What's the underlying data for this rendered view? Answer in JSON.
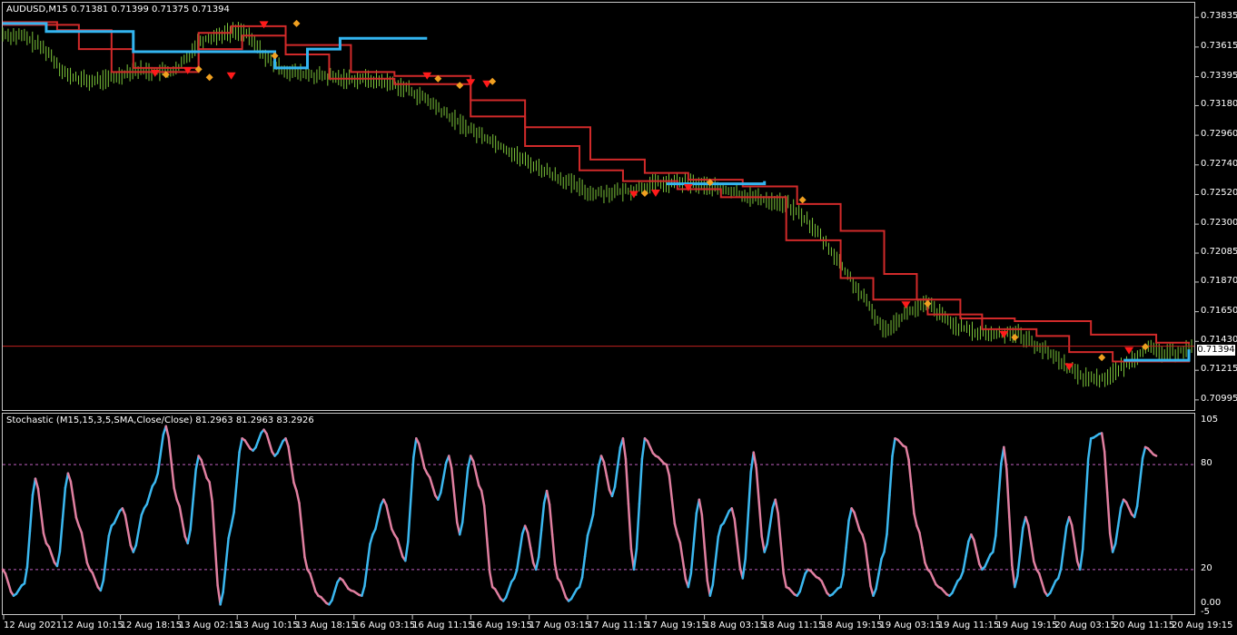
{
  "main_title": "AUDUSD,M15  0.71381 0.71399 0.71375 0.71394",
  "stoch_title": "Stochastic (M15,15,3,5,SMA,Close/Close) 81.2963 81.2963 83.2926",
  "current_price": "0.71394",
  "colors": {
    "background": "#000000",
    "frame": "#c8c8c8",
    "bars": "#7cc53a",
    "resistance_line": "#d12a2a",
    "support_line": "#33b5f0",
    "bid_line": "#c0201f",
    "sell_marker": "#ff1a1a",
    "signal_marker": "#f0a020",
    "stoch_up": "#3bb8f0",
    "stoch_down": "#e07fa0",
    "level_line": "#c060c0"
  },
  "chart_data": [
    {
      "type": "line",
      "subtype": "price-bars-with-trailing-stops",
      "symbol": "AUDUSD",
      "timeframe": "M15",
      "y_ticks": [
        "0.73835",
        "0.73615",
        "0.73395",
        "0.73180",
        "0.72960",
        "0.72740",
        "0.72520",
        "0.72300",
        "0.72085",
        "0.71870",
        "0.71650",
        "0.71430",
        "0.71215",
        "0.70995"
      ],
      "ylim": [
        0.7092,
        0.7387
      ],
      "bid": 0.71394,
      "x_labels": [
        "12 Aug 2021",
        "12 Aug 10:15",
        "12 Aug 18:15",
        "13 Aug 02:15",
        "13 Aug 10:15",
        "13 Aug 18:15",
        "16 Aug 03:15",
        "16 Aug 11:15",
        "16 Aug 19:15",
        "17 Aug 03:15",
        "17 Aug 11:15",
        "17 Aug 19:15",
        "18 Aug 03:15",
        "18 Aug 11:15",
        "18 Aug 19:15",
        "19 Aug 03:15",
        "19 Aug 11:15",
        "19 Aug 19:15",
        "20 Aug 03:15",
        "20 Aug 11:15",
        "20 Aug 19:15"
      ],
      "price_path": [
        [
          0,
          0.7371
        ],
        [
          4,
          0.7369
        ],
        [
          8,
          0.7359
        ],
        [
          12,
          0.734
        ],
        [
          16,
          0.7336
        ],
        [
          20,
          0.7338
        ],
        [
          24,
          0.7345
        ],
        [
          28,
          0.7343
        ],
        [
          32,
          0.7344
        ],
        [
          36,
          0.7366
        ],
        [
          40,
          0.7371
        ],
        [
          44,
          0.7374
        ],
        [
          46,
          0.7365
        ],
        [
          50,
          0.7347
        ],
        [
          54,
          0.7342
        ],
        [
          58,
          0.734
        ],
        [
          62,
          0.7338
        ],
        [
          66,
          0.7338
        ],
        [
          70,
          0.7336
        ],
        [
          74,
          0.7331
        ],
        [
          78,
          0.7322
        ],
        [
          82,
          0.731
        ],
        [
          86,
          0.73
        ],
        [
          90,
          0.7292
        ],
        [
          96,
          0.7277
        ],
        [
          102,
          0.7265
        ],
        [
          108,
          0.7253
        ],
        [
          114,
          0.7254
        ],
        [
          120,
          0.726
        ],
        [
          126,
          0.7261
        ],
        [
          132,
          0.7256
        ],
        [
          138,
          0.725
        ],
        [
          144,
          0.7245
        ],
        [
          148,
          0.7232
        ],
        [
          152,
          0.7212
        ],
        [
          156,
          0.7188
        ],
        [
          160,
          0.7164
        ],
        [
          162,
          0.7151
        ],
        [
          166,
          0.7164
        ],
        [
          170,
          0.7171
        ],
        [
          174,
          0.7157
        ],
        [
          178,
          0.715
        ],
        [
          182,
          0.7148
        ],
        [
          186,
          0.715
        ],
        [
          190,
          0.714
        ],
        [
          194,
          0.713
        ],
        [
          198,
          0.7117
        ],
        [
          202,
          0.7115
        ],
        [
          206,
          0.7124
        ],
        [
          210,
          0.7138
        ],
        [
          214,
          0.7133
        ],
        [
          218,
          0.7138
        ]
      ],
      "series": [
        {
          "name": "",
          "role": "resistance-stop",
          "points": [
            [
              0,
              0.738
            ],
            [
              10,
              0.7378
            ],
            [
              14,
              0.736
            ],
            [
              24,
              0.7346
            ],
            [
              36,
              0.7372
            ],
            [
              42,
              0.7377
            ],
            [
              52,
              0.7363
            ],
            [
              64,
              0.7343
            ],
            [
              72,
              0.734
            ],
            [
              86,
              0.7322
            ],
            [
              96,
              0.7302
            ],
            [
              108,
              0.7278
            ],
            [
              118,
              0.7268
            ],
            [
              126,
              0.7263
            ],
            [
              136,
              0.7258
            ],
            [
              146,
              0.7245
            ],
            [
              154,
              0.7225
            ],
            [
              162,
              0.7193
            ],
            [
              168,
              0.7174
            ],
            [
              176,
              0.716
            ],
            [
              186,
              0.7158
            ],
            [
              200,
              0.7148
            ],
            [
              212,
              0.7142
            ],
            [
              218,
              0.7141
            ]
          ]
        },
        {
          "name": "",
          "role": "resistance-stop-2",
          "points": [
            [
              0,
              0.7378
            ],
            [
              10,
              0.7374
            ],
            [
              20,
              0.7343
            ],
            [
              36,
              0.736
            ],
            [
              44,
              0.737
            ],
            [
              52,
              0.7356
            ],
            [
              60,
              0.7338
            ],
            [
              72,
              0.7334
            ],
            [
              86,
              0.731
            ],
            [
              96,
              0.7288
            ],
            [
              106,
              0.727
            ],
            [
              114,
              0.7262
            ],
            [
              124,
              0.7256
            ],
            [
              132,
              0.725
            ],
            [
              144,
              0.7218
            ],
            [
              154,
              0.719
            ],
            [
              160,
              0.7174
            ],
            [
              170,
              0.7163
            ],
            [
              180,
              0.7152
            ],
            [
              190,
              0.7147
            ],
            [
              196,
              0.7135
            ],
            [
              204,
              0.7128
            ],
            [
              218,
              0.7136
            ]
          ]
        },
        {
          "name": "",
          "role": "support-stop",
          "points": [
            [
              0,
              0.7379
            ],
            [
              8,
              0.7373
            ],
            [
              22,
              0.7373
            ],
            [
              24,
              0.7358
            ],
            [
              50,
              0.7346
            ],
            [
              56,
              0.736
            ],
            [
              62,
              0.7368
            ],
            [
              78,
              0.7368
            ]
          ]
        },
        {
          "name": "",
          "role": "support-stop",
          "points": [
            [
              122,
              0.726
            ],
            [
              140,
              0.7262
            ]
          ]
        },
        {
          "name": "",
          "role": "support-stop",
          "points": [
            [
              206,
              0.7129
            ],
            [
              218,
              0.7137
            ]
          ]
        }
      ],
      "sell_markers": [
        [
          28,
          0.7342
        ],
        [
          34,
          0.7344
        ],
        [
          42,
          0.734
        ],
        [
          48,
          0.7378
        ],
        [
          78,
          0.734
        ],
        [
          86,
          0.7335
        ],
        [
          89,
          0.7334
        ],
        [
          116,
          0.7252
        ],
        [
          120,
          0.7253
        ],
        [
          126,
          0.7257
        ],
        [
          166,
          0.717
        ],
        [
          184,
          0.7148
        ],
        [
          196,
          0.7124
        ],
        [
          207,
          0.7136
        ]
      ],
      "signal_markers": [
        [
          30,
          0.7341
        ],
        [
          36,
          0.7345
        ],
        [
          38,
          0.7339
        ],
        [
          50,
          0.7355
        ],
        [
          54,
          0.7379
        ],
        [
          80,
          0.7338
        ],
        [
          84,
          0.7333
        ],
        [
          90,
          0.7336
        ],
        [
          118,
          0.7253
        ],
        [
          130,
          0.7261
        ],
        [
          147,
          0.7248
        ],
        [
          170,
          0.7171
        ],
        [
          186,
          0.7146
        ],
        [
          202,
          0.7131
        ],
        [
          210,
          0.7139
        ]
      ]
    },
    {
      "type": "line",
      "subtype": "stochastic-oscillator",
      "title": "Stochastic (M15,15,3,5,SMA,Close/Close)",
      "values_readout": [
        81.2963,
        81.2963,
        83.2926
      ],
      "ylim": [
        -5,
        105
      ],
      "y_ticks": [
        "105",
        "80",
        "20",
        "0.00",
        "-5"
      ],
      "levels": [
        80,
        20
      ],
      "main_line": [
        [
          0,
          20
        ],
        [
          2,
          5
        ],
        [
          4,
          12
        ],
        [
          6,
          72
        ],
        [
          8,
          35
        ],
        [
          10,
          22
        ],
        [
          12,
          75
        ],
        [
          14,
          45
        ],
        [
          16,
          20
        ],
        [
          18,
          8
        ],
        [
          20,
          45
        ],
        [
          22,
          55
        ],
        [
          24,
          30
        ],
        [
          26,
          55
        ],
        [
          28,
          70
        ],
        [
          30,
          102
        ],
        [
          32,
          60
        ],
        [
          34,
          35
        ],
        [
          36,
          85
        ],
        [
          38,
          70
        ],
        [
          40,
          0
        ],
        [
          42,
          45
        ],
        [
          44,
          95
        ],
        [
          46,
          88
        ],
        [
          48,
          100
        ],
        [
          50,
          85
        ],
        [
          52,
          95
        ],
        [
          54,
          65
        ],
        [
          56,
          20
        ],
        [
          58,
          5
        ],
        [
          60,
          0
        ],
        [
          62,
          15
        ],
        [
          64,
          8
        ],
        [
          66,
          5
        ],
        [
          68,
          40
        ],
        [
          70,
          60
        ],
        [
          72,
          40
        ],
        [
          74,
          25
        ],
        [
          76,
          95
        ],
        [
          78,
          75
        ],
        [
          80,
          60
        ],
        [
          82,
          85
        ],
        [
          84,
          40
        ],
        [
          86,
          85
        ],
        [
          88,
          65
        ],
        [
          90,
          10
        ],
        [
          92,
          2
        ],
        [
          94,
          15
        ],
        [
          96,
          45
        ],
        [
          98,
          20
        ],
        [
          100,
          65
        ],
        [
          102,
          15
        ],
        [
          104,
          2
        ],
        [
          106,
          10
        ],
        [
          108,
          45
        ],
        [
          110,
          85
        ],
        [
          112,
          62
        ],
        [
          114,
          95
        ],
        [
          116,
          20
        ],
        [
          118,
          95
        ],
        [
          120,
          85
        ],
        [
          122,
          80
        ],
        [
          124,
          40
        ],
        [
          126,
          10
        ],
        [
          128,
          60
        ],
        [
          130,
          5
        ],
        [
          132,
          45
        ],
        [
          134,
          55
        ],
        [
          136,
          15
        ],
        [
          138,
          87
        ],
        [
          140,
          30
        ],
        [
          142,
          60
        ],
        [
          144,
          10
        ],
        [
          146,
          5
        ],
        [
          148,
          20
        ],
        [
          150,
          15
        ],
        [
          152,
          5
        ],
        [
          154,
          10
        ],
        [
          156,
          55
        ],
        [
          158,
          40
        ],
        [
          160,
          5
        ],
        [
          162,
          30
        ],
        [
          164,
          95
        ],
        [
          166,
          90
        ],
        [
          168,
          45
        ],
        [
          170,
          20
        ],
        [
          172,
          10
        ],
        [
          174,
          5
        ],
        [
          176,
          15
        ],
        [
          178,
          40
        ],
        [
          180,
          20
        ],
        [
          182,
          30
        ],
        [
          184,
          90
        ],
        [
          186,
          10
        ],
        [
          188,
          50
        ],
        [
          190,
          20
        ],
        [
          192,
          5
        ],
        [
          194,
          15
        ],
        [
          196,
          50
        ],
        [
          198,
          20
        ],
        [
          200,
          95
        ],
        [
          202,
          98
        ],
        [
          204,
          30
        ],
        [
          206,
          60
        ],
        [
          208,
          50
        ],
        [
          210,
          90
        ],
        [
          212,
          85
        ]
      ],
      "xlim": [
        0,
        219
      ]
    }
  ]
}
